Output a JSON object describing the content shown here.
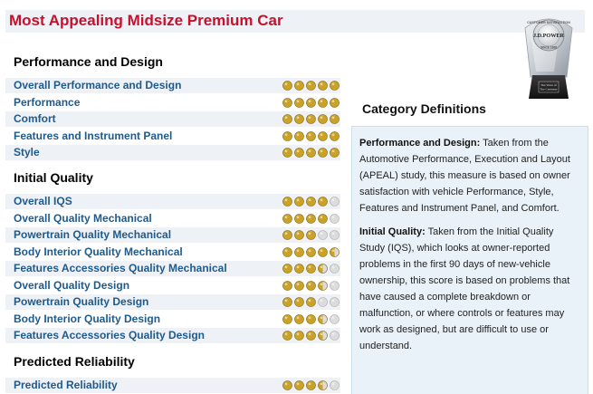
{
  "page_title": "Most Appealing Midsize Premium Car",
  "sections": [
    {
      "title": "Performance and Design",
      "rows": [
        {
          "label": "Overall Performance and Design",
          "rating": 5
        },
        {
          "label": "Performance",
          "rating": 5
        },
        {
          "label": "Comfort",
          "rating": 5
        },
        {
          "label": "Features and Instrument Panel",
          "rating": 5
        },
        {
          "label": "Style",
          "rating": 5
        }
      ]
    },
    {
      "title": "Initial Quality",
      "rows": [
        {
          "label": "Overall IQS",
          "rating": 4
        },
        {
          "label": "Overall Quality Mechanical",
          "rating": 4
        },
        {
          "label": "Powertrain Quality Mechanical",
          "rating": 3
        },
        {
          "label": "Body Interior Quality Mechanical",
          "rating": 4.5
        },
        {
          "label": "Features Accessories Quality Mechanical",
          "rating": 3.5
        },
        {
          "label": "Overall Quality Design",
          "rating": 3.5
        },
        {
          "label": "Powertrain Quality Design",
          "rating": 3
        },
        {
          "label": "Body Interior Quality Design",
          "rating": 3.5
        },
        {
          "label": "Features Accessories Quality Design",
          "rating": 3.5
        }
      ]
    },
    {
      "title": "Predicted Reliability",
      "rows": [
        {
          "label": "Predicted Reliability",
          "rating": 3.5
        }
      ]
    }
  ],
  "rating_max": 5,
  "definitions": {
    "title": "Category Definitions",
    "items": [
      {
        "term": "Performance and Design:",
        "text": " Taken from the Automotive Performance, Execution and Layout (APEAL) study, this measure is based on owner satisfaction with vehicle Performance, Style, Features and Instrument Panel, and Comfort."
      },
      {
        "term": "Initial Quality:",
        "text": " Taken from the Initial Quality Study (IQS), which looks at owner-reported problems in the first 90 days of new-vehicle ownership, this score is based on problems that have caused a complete breakdown or malfunction, or where controls or features may work as designed, but are difficult to use or understand."
      }
    ]
  },
  "badge": {
    "ring_text": "CUSTOMER SATISFACTION",
    "brand": "J.D.POWER",
    "since": "SINCE 1968",
    "voice_line1": "The Voice of",
    "voice_line2": "The Customer"
  },
  "colors": {
    "title_red": "#c8102e",
    "link_blue": "#1f5a8c",
    "dot_gold": "#c9a227",
    "dot_empty": "#dcdcdc",
    "row_alt": "#eef1f5",
    "defs_bg": "#e8f2f8"
  }
}
